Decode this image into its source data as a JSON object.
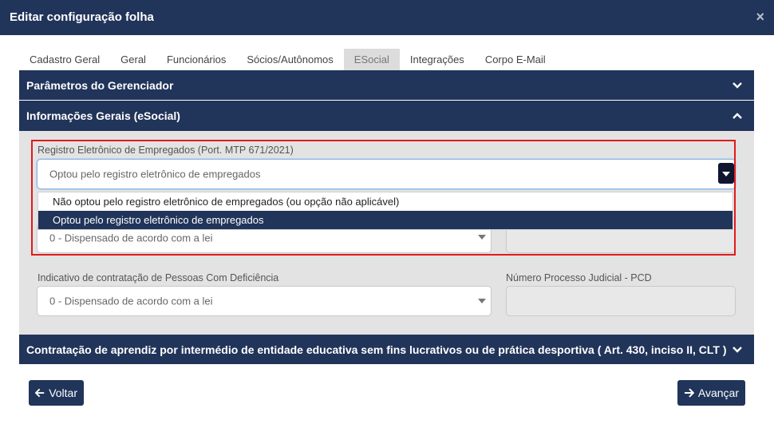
{
  "dialog": {
    "title": "Editar configuração folha",
    "close_icon": "×"
  },
  "tabs": [
    {
      "label": "Cadastro Geral"
    },
    {
      "label": "Geral"
    },
    {
      "label": "Funcionários"
    },
    {
      "label": "Sócios/Autônomos"
    },
    {
      "label": "ESocial",
      "active": true
    },
    {
      "label": "Integrações"
    },
    {
      "label": "Corpo E-Mail"
    }
  ],
  "sections": {
    "gerenciador": "Parâmetros do Gerenciador",
    "informacoes": "Informações Gerais (eSocial)",
    "aprendiz": "Contratação de aprendiz por intermédio de entidade educativa sem fins lucrativos ou de prática desportiva ( Art. 430, inciso II, CLT )"
  },
  "form": {
    "registro_label": "Registro Eletrônico de Empregados (Port. MTP 671/2021)",
    "registro_value": "Optou pelo registro eletrônico de empregados",
    "registro_options": [
      "Não optou pelo registro eletrônico de empregados (ou opção não aplicável)",
      "Optou pelo registro eletrônico de empregados"
    ],
    "hidden_select_value": "0 - Dispensado de acordo com a lei",
    "pcd_label": "Indicativo de contratação de Pessoas Com Deficiência",
    "pcd_value": "0 - Dispensado de acordo com a lei",
    "processo_label": "Número Processo Judicial - PCD"
  },
  "footer": {
    "back_label": "Voltar",
    "next_label": "Avançar"
  },
  "colors": {
    "primary": "#21345a",
    "panel": "#e3e3e3",
    "highlight_border": "#e01b1b"
  }
}
